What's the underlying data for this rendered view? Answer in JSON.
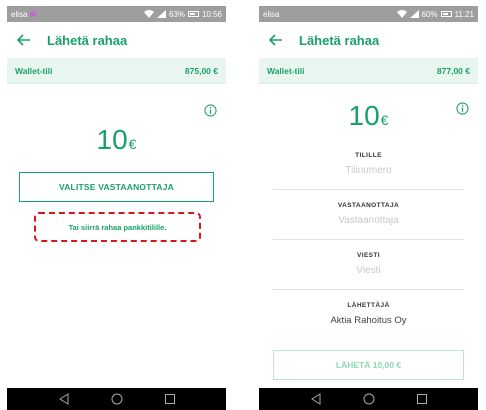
{
  "left": {
    "status": {
      "carrier": "elisa",
      "battery": "63%",
      "time": "10:56"
    },
    "appbar": {
      "title": "Lähetä rahaa"
    },
    "wallet": {
      "label": "Wallet-tili",
      "balance": "875,00 €"
    },
    "amount": {
      "value": "10",
      "currency": "€"
    },
    "select_button": "VALITSE VASTAANOTTAJA",
    "bank_link": "Tai siirrä rahaa pankkitilille."
  },
  "right": {
    "status": {
      "carrier": "elisa",
      "battery": "60%",
      "time": "11:21"
    },
    "appbar": {
      "title": "Lähetä rahaa"
    },
    "wallet": {
      "label": "Wallet-tili",
      "balance": "877,00 €"
    },
    "amount": {
      "value": "10",
      "currency": "€"
    },
    "fields": {
      "account": {
        "label": "TILILLE",
        "placeholder": "Tilinumero"
      },
      "recipient": {
        "label": "VASTAANOTTAJA",
        "placeholder": "Vastaanottaja"
      },
      "message": {
        "label": "VIESTI",
        "placeholder": "Viesti"
      },
      "sender": {
        "label": "LÄHETTÄJÄ",
        "value": "Aktia Rahoitus Oy"
      }
    },
    "send_button": "LÄHETÄ 10,00 €"
  },
  "colors": {
    "brand": "#1aa06b",
    "highlight": "#d5171b",
    "wallet_bg": "#e9f6ef"
  }
}
